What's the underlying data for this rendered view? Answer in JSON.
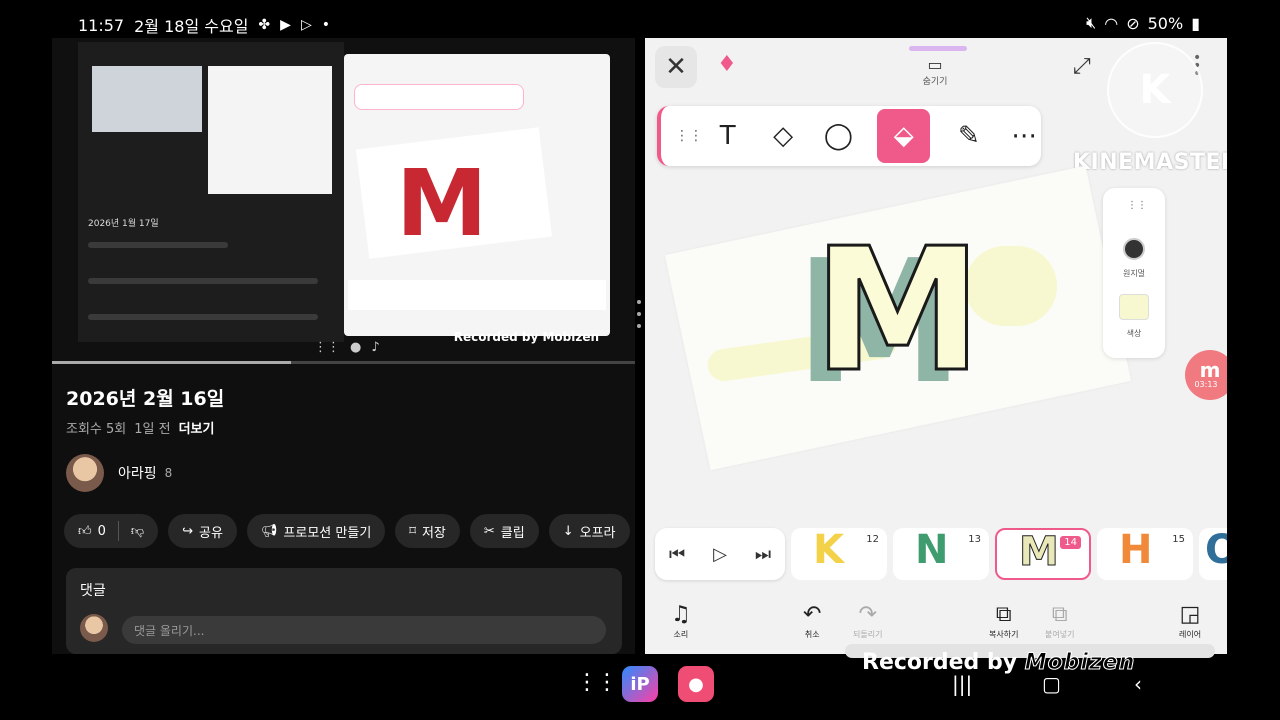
{
  "status": {
    "time": "11:57",
    "date": "2월 18일 수요일",
    "battery": "50%",
    "icons_left": [
      "pinwheel-icon",
      "youtube-icon",
      "play-store-icon",
      "dot-icon"
    ],
    "icons_right": [
      "mute-icon",
      "wifi-icon",
      "do-not-disturb-icon",
      "battery-icon"
    ]
  },
  "youtube": {
    "video_title": "2026년 2월 16일",
    "views": "조회수 5회",
    "age": "1일 전",
    "more": "더보기",
    "channel_name": "아라핑",
    "subscribers": "8",
    "like_count": "0",
    "actions": [
      "공유",
      "프로모션 만들기",
      "저장",
      "클립",
      "오프라"
    ],
    "comments_title": "댓글",
    "comment_placeholder": "댓글 올리기...",
    "mini_recorded": "Recorded by Mobizen",
    "mini_thumb_date": "2026년 1월 17일",
    "mini_letter": "M"
  },
  "kinemaster": {
    "top_center_label": "숨기기",
    "brand": "KINEMASTER",
    "brand_initial": "K",
    "tools": [
      "grip-icon",
      "text-tool-icon",
      "eraser-icon",
      "lasso-icon",
      "fill-bucket-icon",
      "brush-icon",
      "more-icon"
    ],
    "color_panel": {
      "size_label": "원지멀",
      "color_label": "색상",
      "fill_color": "#f8f8d0"
    },
    "canvas_letter": "M",
    "bubble_time": "03:13",
    "bubble_letter": "m",
    "frames": [
      {
        "label": "K",
        "number": "12",
        "color": "#f3d24a"
      },
      {
        "label": "N",
        "number": "13",
        "color": "#3f9c6e"
      },
      {
        "label": "M",
        "number": "14",
        "color": "#f8f8d0"
      },
      {
        "label": "H",
        "number": "15",
        "color": "#f08a3a"
      },
      {
        "label": "O",
        "number": "",
        "color": "#2f6f9a"
      }
    ],
    "bottom": [
      "소리",
      "취소",
      "되돌리기",
      "복사하기",
      "붙여넣기",
      "레이어"
    ],
    "recorded_prefix": "Recorded by",
    "recorded_brand": "Mobizen",
    "accent": "#f05a8a"
  },
  "navbar": {
    "apps": [
      "ibis-paint-icon",
      "screen-recorder-icon"
    ]
  }
}
